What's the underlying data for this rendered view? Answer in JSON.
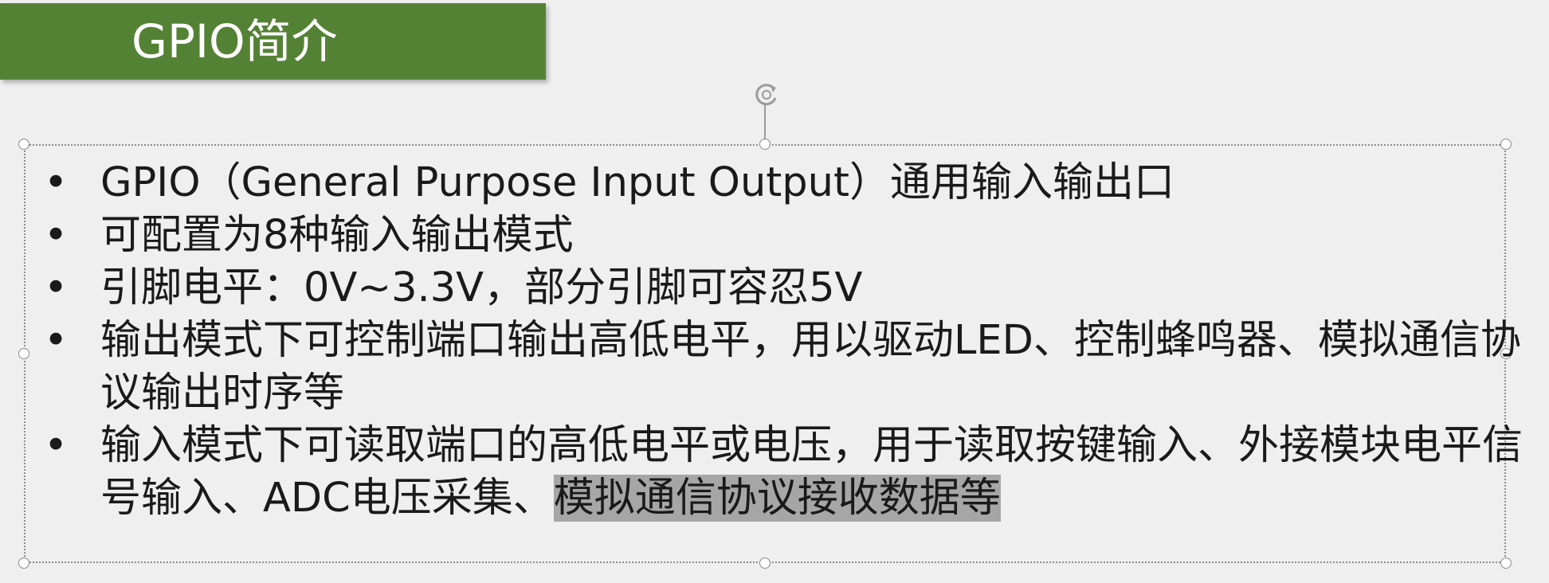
{
  "slide": {
    "title": "GPIO简介",
    "accent_color": "#548235",
    "bullet_symbol": "•",
    "bullets": [
      {
        "text": "GPIO（General Purpose Input Output）通用输入输出口"
      },
      {
        "text": "可配置为8种输入输出模式"
      },
      {
        "text": "引脚电平：0V~3.3V，部分引脚可容忍5V"
      },
      {
        "text": "输出模式下可控制端口输出高低电平，用以驱动LED、控制蜂鸣器、模拟通信协议输出时序等"
      },
      {
        "text": "输入模式下可读取端口的高低电平或电压，用于读取按键输入、外接模块电平信号输入、ADC电压采集、",
        "highlighted_text": "模拟通信协议接收数据等"
      }
    ]
  },
  "icons": {
    "rotate_handle": "rotate-icon"
  }
}
